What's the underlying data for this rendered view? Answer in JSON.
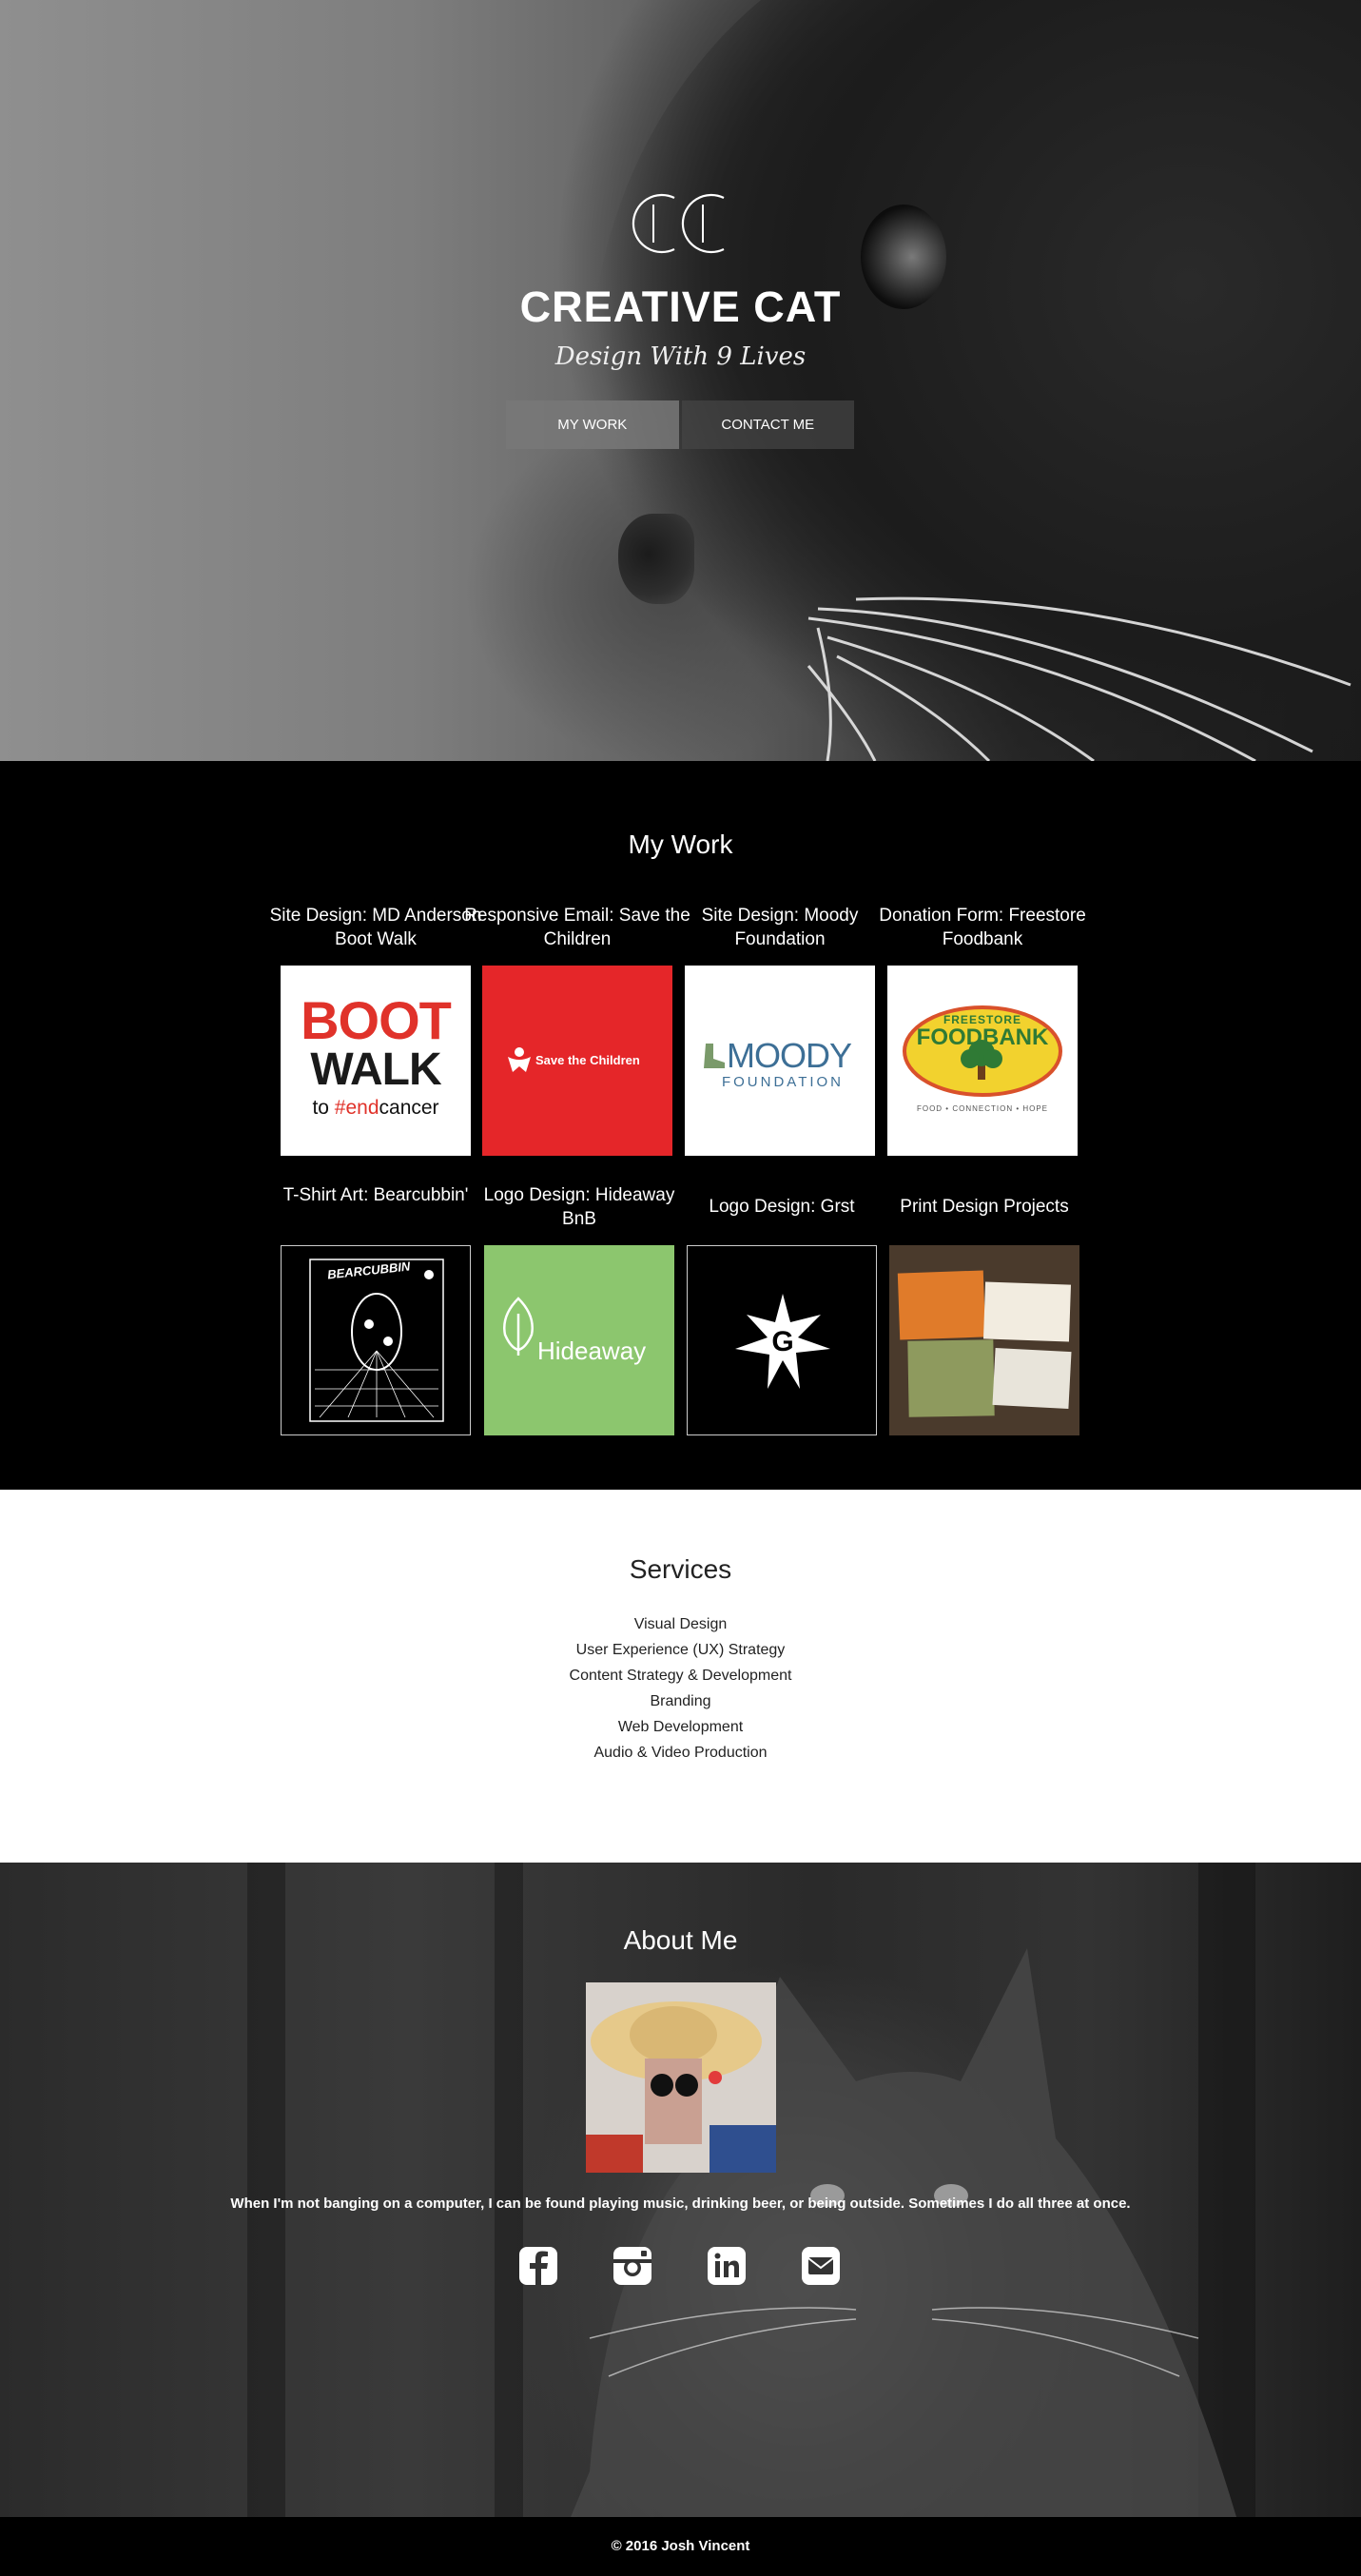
{
  "hero": {
    "logo_text": "CC",
    "title": "CREATIVE CAT",
    "tagline": "Design With 9 Lives",
    "buttons": [
      {
        "label": "MY WORK"
      },
      {
        "label": "CONTACT ME"
      }
    ]
  },
  "work": {
    "title": "My Work",
    "items": [
      {
        "caption": "Site Design: MD Anderson Boot Walk",
        "logo": {
          "line1": "BOOT",
          "line2": "WALK",
          "line3a": "to ",
          "line3b": "#end",
          "line3c": "cancer"
        }
      },
      {
        "caption": "Responsive Email: Save the Children",
        "logo": {
          "text": "Save the Children"
        }
      },
      {
        "caption": "Site Design: Moody Foundation",
        "logo": {
          "line1": "MOODY",
          "line2": "FOUNDATION"
        }
      },
      {
        "caption": "Donation Form: Freestore Foodbank",
        "logo": {
          "line1": "FREESTORE",
          "line2": "FOODBANK",
          "line3": "FOOD • CONNECTION • HOPE"
        }
      },
      {
        "caption": "T-Shirt Art: Bearcubbin'",
        "logo": {
          "text": "BEARCUBBIN"
        }
      },
      {
        "caption": "Logo Design: Hideaway BnB",
        "logo": {
          "text": "Hideaway"
        }
      },
      {
        "caption": "Logo Design: Grst",
        "logo": {
          "text": "G"
        }
      },
      {
        "caption": "Print Design Projects",
        "logo": {
          "text": ""
        }
      }
    ]
  },
  "services": {
    "title": "Services",
    "items": [
      "Visual Design",
      "User Experience (UX) Strategy",
      "Content Strategy & Development",
      "Branding",
      "Web Development",
      "Audio & Video Production"
    ]
  },
  "about": {
    "title": "About Me",
    "bio": "When I'm not banging on a computer, I can be found playing music, drinking beer, or being outside. Sometimes I do all three at once.",
    "socials": [
      "facebook-icon",
      "instagram-icon",
      "linkedin-icon",
      "email-icon"
    ]
  },
  "footer": {
    "copyright": "© 2016 Josh Vincent"
  },
  "colors": {
    "boot_red": "#e0322a",
    "save_red": "#e52629",
    "moody_blue": "#3d6f96",
    "foodbank_green": "#2f7a35",
    "hideaway_green": "#8cc66e"
  }
}
